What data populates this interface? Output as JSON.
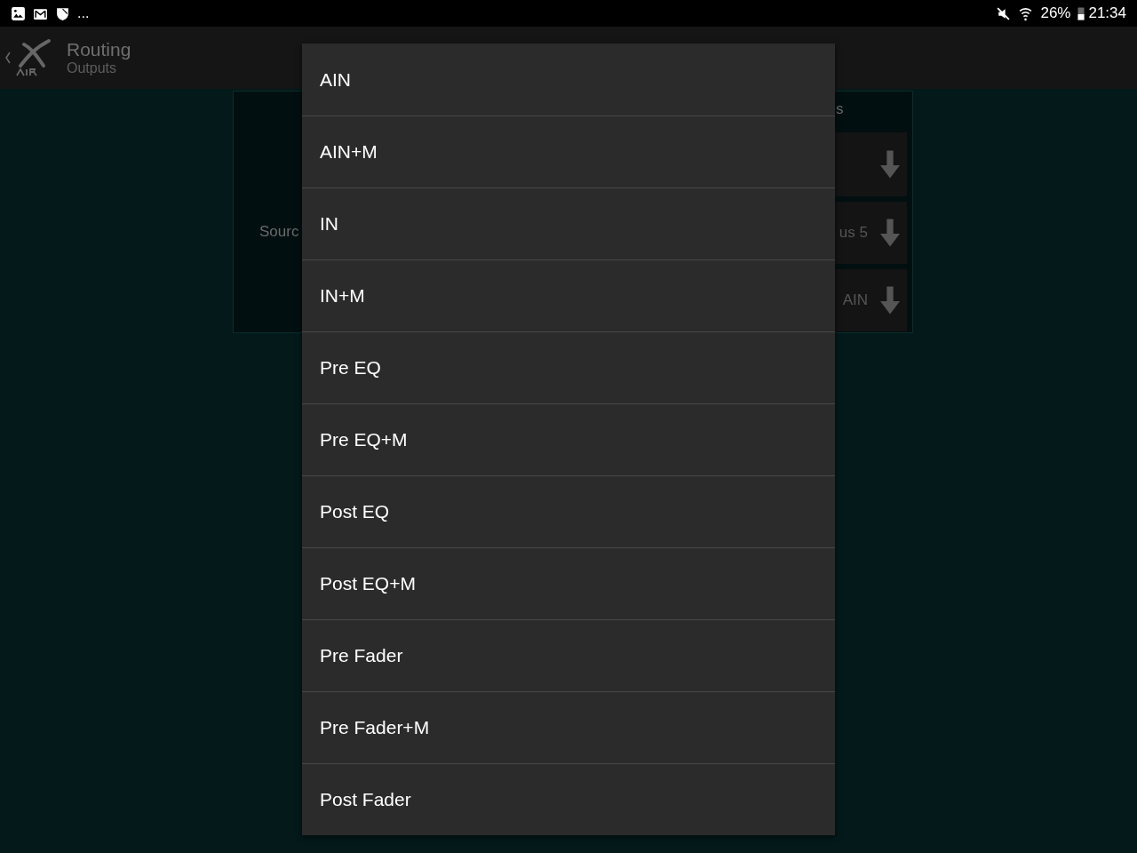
{
  "status_bar": {
    "more": "...",
    "battery": "26%",
    "time": "21:34"
  },
  "header": {
    "title": "Routing",
    "subtitle": "Outputs"
  },
  "panel": {
    "source_label": "Sourc",
    "column_label": "s",
    "selects": [
      {
        "kind": "blank"
      },
      {
        "kind": "value",
        "value": "us 5"
      },
      {
        "kind": "value",
        "value": "AIN"
      }
    ]
  },
  "dropdown": {
    "options": [
      "AIN",
      "AIN+M",
      "IN",
      "IN+M",
      "Pre EQ",
      "Pre EQ+M",
      "Post EQ",
      "Post EQ+M",
      "Pre Fader",
      "Pre Fader+M",
      "Post Fader"
    ]
  }
}
